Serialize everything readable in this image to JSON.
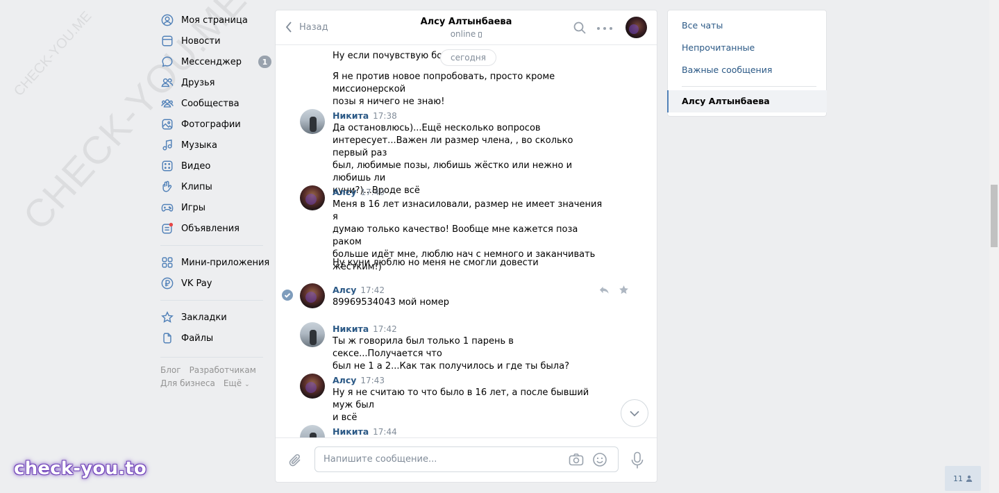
{
  "watermarks": {
    "diagonal_big": "CHECK-YOU.ME",
    "diagonal_small": "CHECK-YOU.ME",
    "logo": "check-you.to"
  },
  "nav": {
    "items": [
      {
        "label": "Моя страница",
        "icon": "user-circle-icon"
      },
      {
        "label": "Новости",
        "icon": "news-icon"
      },
      {
        "label": "Мессенджер",
        "icon": "chat-bubble-icon",
        "badge": "1"
      },
      {
        "label": "Друзья",
        "icon": "friends-icon"
      },
      {
        "label": "Сообщества",
        "icon": "communities-icon"
      },
      {
        "label": "Фотографии",
        "icon": "photo-icon"
      },
      {
        "label": "Музыка",
        "icon": "music-icon"
      },
      {
        "label": "Видео",
        "icon": "video-icon"
      },
      {
        "label": "Клипы",
        "icon": "clips-icon"
      },
      {
        "label": "Игры",
        "icon": "gamepad-icon"
      },
      {
        "label": "Объявления",
        "icon": "ads-icon"
      }
    ],
    "items2": [
      {
        "label": "Мини-приложения",
        "icon": "apps-grid-icon"
      },
      {
        "label": "VK Pay",
        "icon": "ruble-icon"
      }
    ],
    "items3": [
      {
        "label": "Закладки",
        "icon": "star-icon"
      },
      {
        "label": "Файлы",
        "icon": "file-icon"
      }
    ],
    "footer": {
      "blog": "Блог",
      "devs": "Разработчикам",
      "business": "Для бизнеса",
      "more": "Ещё"
    }
  },
  "chat": {
    "back_label": "Назад",
    "peer_name": "Алсу Алтынбаева",
    "peer_status": "online",
    "date_pill": "сегодня",
    "messages": [
      {
        "text_lines": [
          "Ну если почувствую боль"
        ]
      },
      {
        "text_lines": [
          "Я не против новое попробовать, просто кроме миссионерской",
          "позы я ничего не знаю!"
        ]
      },
      {
        "author": "Никита",
        "time": "17:38",
        "text_lines": [
          "Да остановлюсь)...Ещё несколько вопросов",
          "интересует...Важен ли размер члена, , во сколько первый раз",
          "был, любимые позы, любишь жёстко или нежно и любишь ли",
          "куни?)...Вроде всё"
        ]
      },
      {
        "author": "Алсу",
        "time": "17:40",
        "text_lines": [
          "Меня в 16 лет изнасиловали, размер не имеет значения я",
          "думаю только качество! Вообще мне кажется поза раком",
          "больше идёт мне, люблю нач с немного и заканчивать",
          "жёстким!)"
        ]
      },
      {
        "text_lines": [
          "Ну куни люблю но меня не смогли довести"
        ]
      },
      {
        "author": "Алсу",
        "time": "17:42",
        "text_lines": [
          "89969534043 мой номер"
        ]
      },
      {
        "author": "Никита",
        "time": "17:42",
        "text_lines": [
          "Ты ж говорила был только 1 парень в сексе...Получается что",
          "был не 1 а 2...Как так получилось и где ты была?"
        ]
      },
      {
        "author": "Алсу",
        "time": "17:43",
        "text_lines": [
          "Ну я не считаю то что было в 16 лет, а после бывший муж был",
          "и всё"
        ]
      },
      {
        "author": "Никита",
        "time": "17:44"
      }
    ],
    "composer_placeholder": "Напишите сообщение..."
  },
  "right_panel": {
    "all_chats": "Все чаты",
    "unread": "Непрочитанные",
    "important": "Важные сообщения",
    "active_chat": "Алсу Алтынбаева"
  },
  "online_counter": "11",
  "colors": {
    "link": "#2a5885",
    "icon_blue": "#5181b8",
    "bg": "#edeef0",
    "muted": "#818c99"
  }
}
